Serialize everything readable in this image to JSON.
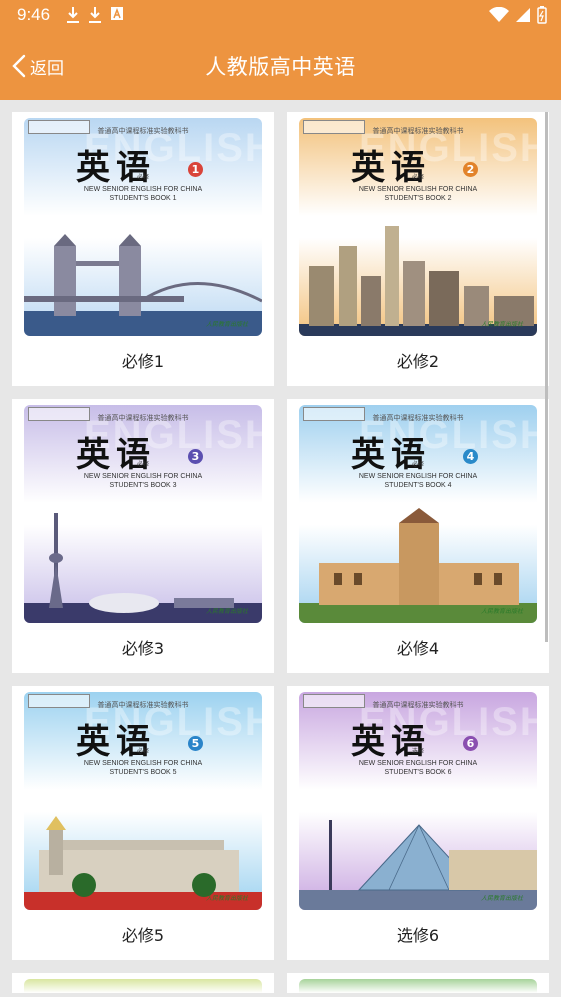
{
  "status_bar": {
    "time": "9:46"
  },
  "header": {
    "back_label": "返回",
    "title": "人教版高中英语"
  },
  "colors": {
    "header": "#ed9440",
    "background": "#e7e7e7"
  },
  "books": [
    {
      "label": "必修1",
      "cover": {
        "series": "普通高中课程标准实验教科书",
        "title_cn": "英语",
        "number": "1",
        "level": "必修",
        "subtitle_en": "NEW SENIOR ENGLISH FOR CHINA",
        "book_en": "STUDENT'S BOOK 1",
        "watermark": "ENGLISH",
        "accent": "#d9443a",
        "sky": "#b9d7f2",
        "scene": "tower-bridge"
      }
    },
    {
      "label": "必修2",
      "cover": {
        "series": "普通高中课程标准实验教科书",
        "title_cn": "英语",
        "number": "2",
        "level": "必修",
        "subtitle_en": "NEW SENIOR ENGLISH FOR CHINA",
        "book_en": "STUDENT'S BOOK 2",
        "watermark": "ENGLISH",
        "accent": "#e2832a",
        "sky": "#f3c27c",
        "scene": "skyline"
      }
    },
    {
      "label": "必修3",
      "cover": {
        "series": "普通高中课程标准实验教科书",
        "title_cn": "英语",
        "number": "3",
        "level": "必修",
        "subtitle_en": "NEW SENIOR ENGLISH FOR CHINA",
        "book_en": "STUDENT'S BOOK 3",
        "watermark": "ENGLISH",
        "accent": "#5b4fb0",
        "sky": "#c7bde8",
        "scene": "cn-tower"
      }
    },
    {
      "label": "必修4",
      "cover": {
        "series": "普通高中课程标准实验教科书",
        "title_cn": "英语",
        "number": "4",
        "level": "必修",
        "subtitle_en": "NEW SENIOR ENGLISH FOR CHINA",
        "book_en": "STUDENT'S BOOK 4",
        "watermark": "ENGLISH",
        "accent": "#2a8ac9",
        "sky": "#9fd0ef",
        "scene": "station"
      }
    },
    {
      "label": "必修5",
      "cover": {
        "series": "普通高中课程标准实验教科书",
        "title_cn": "英语",
        "number": "5",
        "level": "必修",
        "subtitle_en": "NEW SENIOR ENGLISH FOR CHINA",
        "book_en": "STUDENT'S BOOK 5",
        "watermark": "ENGLISH",
        "accent": "#2a84c9",
        "sky": "#9cd2f0",
        "scene": "palace"
      }
    },
    {
      "label": "选修6",
      "cover": {
        "series": "普通高中课程标准实验教科书",
        "title_cn": "英语",
        "number": "6",
        "level": "选修",
        "subtitle_en": "NEW SENIOR ENGLISH FOR CHINA",
        "book_en": "STUDENT'S BOOK 6",
        "watermark": "ENGLISH",
        "accent": "#8a4fb0",
        "sky": "#c8a6e0",
        "scene": "louvre"
      }
    }
  ]
}
